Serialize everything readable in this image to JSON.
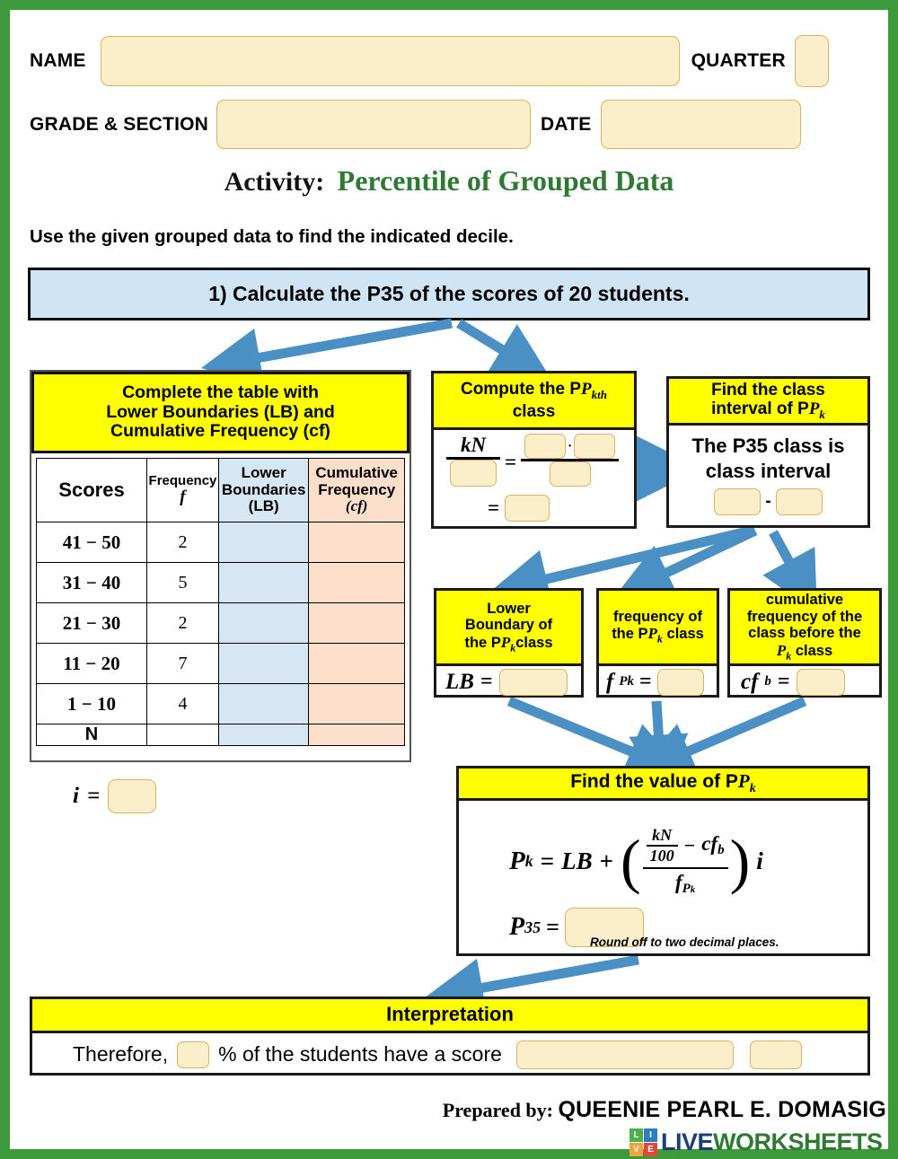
{
  "header": {
    "name_label": "NAME",
    "quarter_label": "QUARTER",
    "grade_label": "GRADE & SECTION",
    "date_label": "DATE",
    "name_value": "",
    "quarter_value": "",
    "grade_value": "",
    "date_value": ""
  },
  "title": {
    "prefix": "Activity:",
    "main": "Percentile of Grouped Data",
    "accent_color": "#2f7a32"
  },
  "instruction": "Use the given grouped data to find the indicated decile.",
  "problem": {
    "text": "1) Calculate the P35 of the scores of 20 students.",
    "bg_color": "#cfe5f5"
  },
  "table_card": {
    "caption_line1": "Complete the table with",
    "caption_line2": "Lower Boundaries (LB) and",
    "caption_line3": "Cumulative Frequency (cf)",
    "caption_color": "#ffff00",
    "columns": [
      {
        "label": "Scores",
        "sub": ""
      },
      {
        "label": "Frequency",
        "sub": "f"
      },
      {
        "label": "Lower Boundaries",
        "sub": "(LB)",
        "bg": "#d6e6f3"
      },
      {
        "label": "Cumulative Frequency",
        "sub": "(cf)",
        "bg": "#fbdfcb"
      }
    ],
    "rows": [
      {
        "score": "41 − 50",
        "f": "2",
        "lb": "",
        "cf": ""
      },
      {
        "score": "31 − 40",
        "f": "5",
        "lb": "",
        "cf": ""
      },
      {
        "score": "21 − 30",
        "f": "2",
        "lb": "",
        "cf": ""
      },
      {
        "score": "11 − 20",
        "f": "7",
        "lb": "",
        "cf": ""
      },
      {
        "score": "1 − 10",
        "f": "4",
        "lb": "",
        "cf": ""
      },
      {
        "score": "N",
        "f": "",
        "lb": "",
        "cf": ""
      }
    ]
  },
  "class_width": {
    "symbol": "i",
    "equals": "=",
    "value": ""
  },
  "compute_box": {
    "caption_line1": "Compute the P",
    "caption_sub": "kth",
    "caption_line2": "class",
    "numerator": "kN",
    "denominator_value": "",
    "eq1": "=",
    "product_left": "",
    "product_dot": "·",
    "product_right": "",
    "product_den": "",
    "eq2": "=",
    "result": ""
  },
  "interval_box": {
    "caption_line1": "Find the class",
    "caption_line2": "interval of P",
    "caption_sub": "k",
    "line1": "The P35 class is",
    "line2": "class interval",
    "lower": "",
    "dash": "-",
    "upper": ""
  },
  "lb_box": {
    "caption_line1": "Lower",
    "caption_line2": "Boundary of",
    "caption_line3": "the P",
    "caption_sub": "k",
    "caption_line4": "class",
    "symbol": "LB",
    "equals": "=",
    "value": ""
  },
  "fpk_box": {
    "caption_line1": "frequency of",
    "caption_line2": "the P",
    "caption_sub": "k",
    "caption_line3": "class",
    "symbol_f": "f",
    "symbol_sub": "Pk",
    "equals": "=",
    "value": ""
  },
  "cfb_box": {
    "caption_line1": "cumulative",
    "caption_line2": "frequency of the",
    "caption_line3": "class before the",
    "caption_line4": "P",
    "caption_sub": "k",
    "caption_line5": "class",
    "symbol_cf": "cf",
    "symbol_sub": "b",
    "equals": "=",
    "value": ""
  },
  "value_box": {
    "caption": "Find the value of P",
    "caption_sub": "k",
    "formula_lhs": "P",
    "formula_lhs_sub": "k",
    "formula_eq": "=",
    "formula_lb": "LB",
    "formula_plus": "+",
    "frac_num_left_top": "kN",
    "frac_num_left_bottom": "100",
    "frac_minus": "−",
    "frac_num_right": "cf",
    "frac_num_right_sub": "b",
    "frac_den_f": "f",
    "frac_den_sub": "P",
    "frac_den_sub2": "k",
    "formula_i": "i",
    "answer_label": "P",
    "answer_sub": "35",
    "answer_eq": "=",
    "answer_value": "",
    "note": "Round off to two decimal places."
  },
  "interpretation": {
    "caption": "Interpretation",
    "text_1": "Therefore,",
    "percent_value": "",
    "text_2": "% of the students have a score",
    "blank_long": "",
    "blank_short": ""
  },
  "footer": {
    "prepared_prefix": "Prepared  by:",
    "author": "QUEENIE PEARL E. DOMASIG",
    "logo_tiles": [
      "L",
      "I",
      "V",
      "E"
    ],
    "logo_tile_colors": [
      "#4caf50",
      "#2f7ec4",
      "#f2a33c",
      "#e0473a"
    ],
    "logo_word_live": "LIVE",
    "logo_word_worksheets": "WORKSHEETS"
  },
  "theme": {
    "page_border": "#3c9a3c",
    "caption_yellow": "#ffff00",
    "field_fill": "#fbeecb",
    "field_border": "#d9b45a",
    "arrow_color": "#4a90c4",
    "lb_col": "#d6e6f3",
    "cf_col": "#fbdfcb"
  }
}
